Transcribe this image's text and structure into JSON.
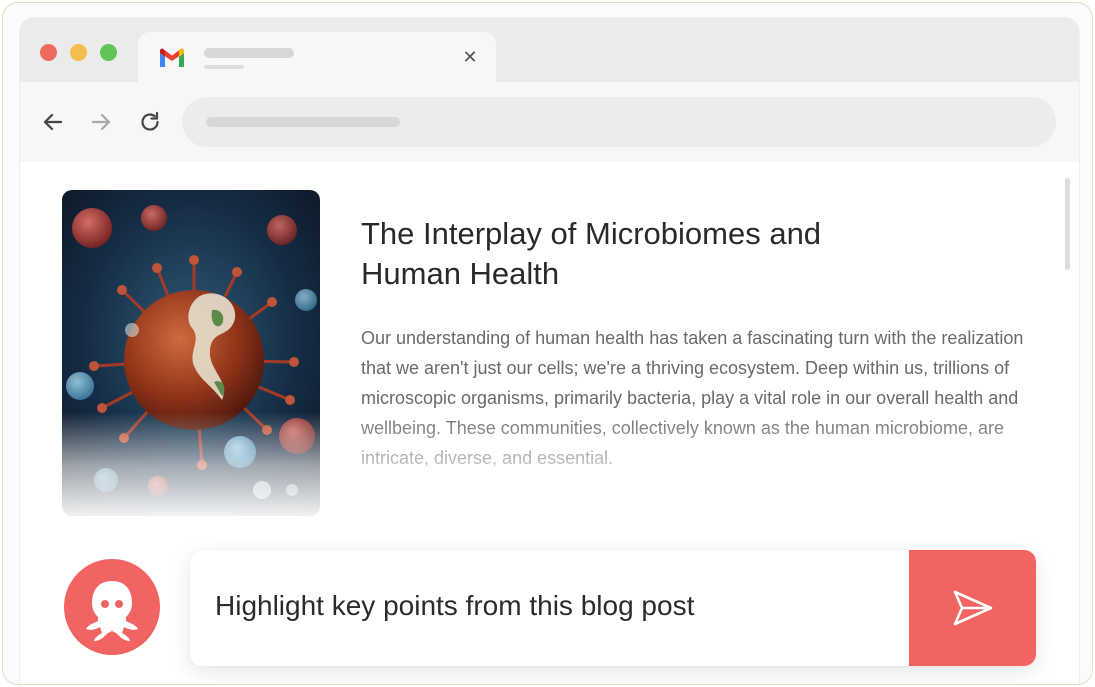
{
  "browser": {
    "tab": {
      "favicon": "gmail-icon",
      "close_icon": "✕"
    },
    "nav": {
      "back_icon": "arrow-left-icon",
      "forward_icon": "arrow-right-icon",
      "reload_icon": "reload-icon"
    }
  },
  "article": {
    "title": "The Interplay of Microbiomes and Human Health",
    "body": "Our understanding of human health has taken a fascinating turn with the realization that we aren't just our cells; we're a thriving ecosystem. Deep within us, trillions of microscopic organisms, primarily bacteria, play a vital role in our overall health and wellbeing. These communities, collectively known as the human microbiome, are intricate, diverse, and essential."
  },
  "assistant": {
    "avatar_icon": "octopus-icon",
    "prompt": "Highlight key points from this blog post",
    "send_icon": "send-icon"
  },
  "colors": {
    "accent": "#f26461",
    "title": "#2a2a2a",
    "body": "#6a6a6a"
  }
}
